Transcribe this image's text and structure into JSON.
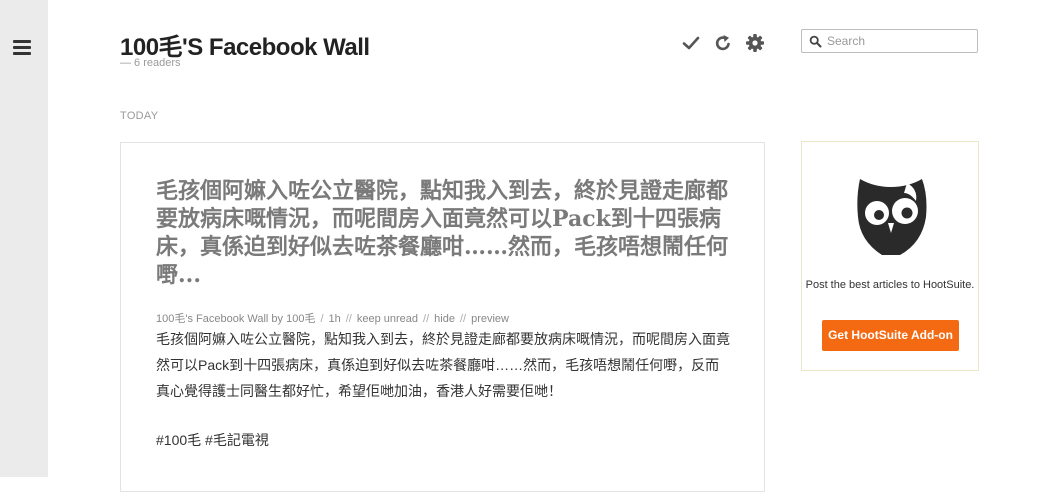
{
  "feed": {
    "title": "100毛'S Facebook Wall",
    "readers": "— 6 readers"
  },
  "toolbar": {
    "mark_read_icon": "check-icon",
    "refresh_icon": "refresh-icon",
    "settings_icon": "gear-icon"
  },
  "search": {
    "placeholder": "Search",
    "value": ""
  },
  "section": {
    "label": "TODAY"
  },
  "article": {
    "title": "毛孩個阿嫲入咗公立醫院，點知我入到去，終於見證走廊都要放病床嘅情況，而呢間房入面竟然可以Pack到十四張病床，真係迫到好似去咗茶餐廳咁……然而，毛孩唔想鬧任何嘢...",
    "meta": {
      "source": "100毛's Facebook Wall by 100毛",
      "age": "1h",
      "keep_unread": "keep unread",
      "hide": "hide",
      "preview": "preview",
      "separator": "//",
      "source_sep": "/"
    },
    "summary": "毛孩個阿嫲入咗公立醫院，點知我入到去，終於見證走廊都要放病床嘅情況，而呢間房入面竟然可以Pack到十四張病床，真係迫到好似去咗茶餐廳咁……然而，毛孩唔想鬧任何嘢，反而真心覺得護士同醫生都好忙，希望佢哋加油，香港人好需要佢哋！",
    "tags": "#100毛 #毛記電視"
  },
  "promo": {
    "text": "Post the best articles to HootSuite.",
    "button": "Get HootSuite Add-on",
    "icon": "hootsuite-owl-icon",
    "accent": "#f36a13"
  }
}
